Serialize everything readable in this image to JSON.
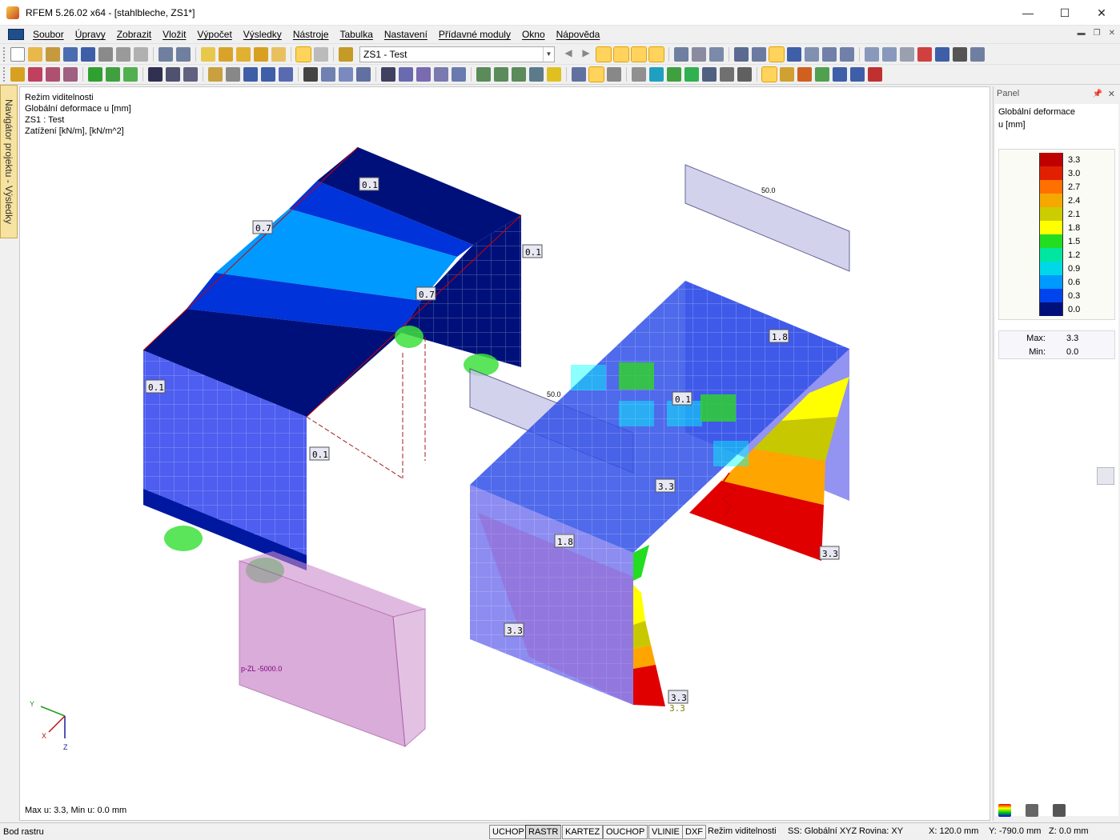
{
  "window": {
    "title": "RFEM 5.26.02 x64 - [stahlbleche, ZS1*]",
    "minimize_glyph": "—",
    "maximize_glyph": "☐",
    "close_glyph": "✕"
  },
  "menu": {
    "items": [
      "Soubor",
      "Úpravy",
      "Zobrazit",
      "Vložit",
      "Výpočet",
      "Výsledky",
      "Nástroje",
      "Tabulka",
      "Nastavení",
      "Přídavné moduly",
      "Okno",
      "Nápověda"
    ]
  },
  "toolbar": {
    "loadcase_combo": "ZS1 - Test"
  },
  "navigator": {
    "tab_label": "Navigátor projektu - Výsledky"
  },
  "viewport": {
    "info_lines": [
      "Režim viditelnosti",
      "Globální deformace u [mm]",
      "ZS1 : Test",
      "Zatížení [kN/m], [kN/m^2]"
    ],
    "max_min_text": "Max u: 3.3, Min u: 0.0 mm",
    "labels": {
      "a": "0.1",
      "b": "0.7",
      "c": "0.1",
      "d": "0.7",
      "e": "0.1",
      "f": "0.1",
      "g": "1.8",
      "h": "0.1",
      "i": "3.3",
      "j": "1.8",
      "k": "3.3",
      "l": "3.3",
      "m": "3.3",
      "n": "3.3"
    },
    "load_values": {
      "top": "50.0",
      "mid": "50.0",
      "block": "p-ZL -5000.0"
    },
    "axes": {
      "y": "Y",
      "x": "X",
      "z": "Z"
    }
  },
  "panel": {
    "header": "Panel",
    "pin_glyph": "ᵖ",
    "close_glyph": "✕",
    "title": "Globální deformace",
    "unit": "u [mm]",
    "legend": [
      {
        "value": "3.3",
        "color": "#c00000"
      },
      {
        "value": "3.0",
        "color": "#e02000"
      },
      {
        "value": "2.7",
        "color": "#ff7000"
      },
      {
        "value": "2.4",
        "color": "#f5a800"
      },
      {
        "value": "2.1",
        "color": "#cccc00"
      },
      {
        "value": "1.8",
        "color": "#ffff00"
      },
      {
        "value": "1.5",
        "color": "#22dd22"
      },
      {
        "value": "1.2",
        "color": "#00e6a0"
      },
      {
        "value": "0.9",
        "color": "#00d8e8"
      },
      {
        "value": "0.6",
        "color": "#0099ff"
      },
      {
        "value": "0.3",
        "color": "#0044ee"
      },
      {
        "value": "0.0",
        "color": "#00107a"
      }
    ],
    "stats": {
      "max_label": "Max:",
      "max_value": "3.3",
      "min_label": "Min:",
      "min_value": "0.0"
    }
  },
  "statusbar": {
    "left": "Bod rastru",
    "buttons": [
      "UCHOP",
      "RASTR",
      "KARTEZ",
      "OUCHOP",
      "VLINIE",
      "DXF"
    ],
    "mode": "Režim viditelnosti",
    "cs": "SS: Globální XYZ",
    "plane": "Rovina: XY",
    "x": "X:  120.0 mm",
    "y": "Y:  -790.0 mm",
    "z": "Z:  0.0 mm"
  },
  "colors": {
    "accent": "#ffd35c",
    "panel_bg": "#f0f0f0",
    "navtab": "#f7e3a1"
  }
}
